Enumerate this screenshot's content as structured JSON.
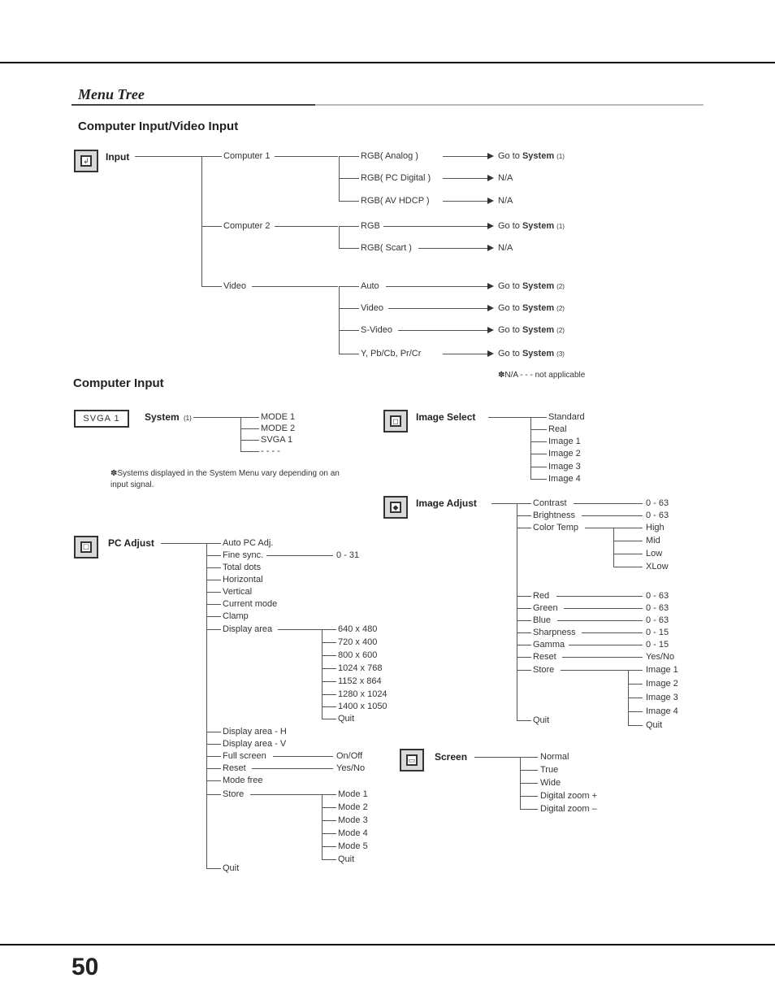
{
  "section_title": "Menu Tree",
  "heading1": "Computer Input/Video Input",
  "heading2": "Computer Input",
  "page_number": "50",
  "input": {
    "label": "Input",
    "computer1": {
      "label": "Computer 1",
      "rgb_analog": "RGB( Analog )",
      "rgb_pc_digital": "RGB( PC Digital )",
      "rgb_av_hdcp": "RGB( AV HDCP )"
    },
    "computer2": {
      "label": "Computer 2",
      "rgb": "RGB",
      "rgb_scart": "RGB( Scart )"
    },
    "video": {
      "label": "Video",
      "auto": "Auto",
      "video": "Video",
      "svideo": "S-Video",
      "ypbcb": "Y, Pb/Cb, Pr/Cr"
    }
  },
  "goto": {
    "system1": "Go to System (1)",
    "system2": "Go to System (2)",
    "system3": "Go to System (3)",
    "na": "N/A"
  },
  "na_note": "✽N/A - - - not applicable",
  "system": {
    "label": "System",
    "sub": "(1)",
    "mode1": "MODE 1",
    "mode2": "MODE 2",
    "svga1": "SVGA 1",
    "dashes": "- - - -",
    "footnote": "✽Systems displayed in the System Menu vary depending on an input signal."
  },
  "svga_icon": "SVGA 1",
  "pc_adjust": {
    "label": "PC Adjust",
    "auto_pc": "Auto PC Adj.",
    "fine_sync": "Fine sync.",
    "fine_sync_val": "0 - 31",
    "total_dots": "Total dots",
    "horizontal": "Horizontal",
    "vertical": "Vertical",
    "current_mode": "Current mode",
    "clamp": "Clamp",
    "display_area": "Display area",
    "resolutions": [
      "640 x 480",
      "720 x 400",
      "800 x 600",
      "1024 x 768",
      "1152 x 864",
      "1280 x 1024",
      "1400 x 1050",
      "Quit"
    ],
    "display_area_h": "Display area - H",
    "display_area_v": "Display area - V",
    "full_screen": "Full screen",
    "full_screen_val": "On/Off",
    "reset": "Reset",
    "reset_val": "Yes/No",
    "mode_free": "Mode free",
    "store": "Store",
    "store_modes": [
      "Mode 1",
      "Mode 2",
      "Mode 3",
      "Mode 4",
      "Mode 5",
      "Quit"
    ],
    "quit": "Quit"
  },
  "image_select": {
    "label": "Image Select",
    "items": [
      "Standard",
      "Real",
      "Image 1",
      "Image 2",
      "Image 3",
      "Image 4"
    ]
  },
  "image_adjust": {
    "label": "Image Adjust",
    "contrast": "Contrast",
    "contrast_v": "0 - 63",
    "brightness": "Brightness",
    "brightness_v": "0 - 63",
    "color_temp": "Color Temp",
    "ct_high": "High",
    "ct_mid": "Mid",
    "ct_low": "Low",
    "ct_xlow": "XLow",
    "red": "Red",
    "red_v": "0 - 63",
    "green": "Green",
    "green_v": "0 - 63",
    "blue": "Blue",
    "blue_v": "0 - 63",
    "sharpness": "Sharpness",
    "sharpness_v": "0 - 15",
    "gamma": "Gamma",
    "gamma_v": "0 - 15",
    "reset": "Reset",
    "reset_v": "Yes/No",
    "store": "Store",
    "store_items": [
      "Image 1",
      "Image 2",
      "Image 3",
      "Image 4",
      "Quit"
    ],
    "quit": "Quit"
  },
  "screen": {
    "label": "Screen",
    "items": [
      "Normal",
      "True",
      "Wide",
      "Digital zoom +",
      "Digital zoom –"
    ]
  }
}
